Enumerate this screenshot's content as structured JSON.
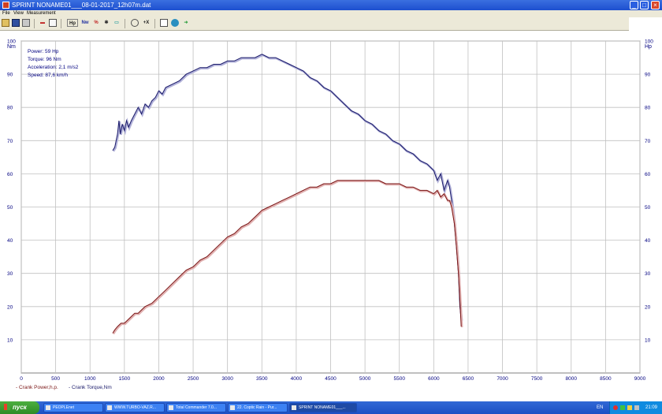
{
  "window": {
    "title": "SPRINT  NONAME01___08-01-2017_12h07m.dat",
    "buttons": {
      "minimize": "_",
      "maximize": "□",
      "close": "×"
    }
  },
  "menu": [
    "File",
    "View",
    "Measurement"
  ],
  "toolbar": {
    "icons": [
      "open-icon",
      "save-icon",
      "print-icon",
      "engine-icon",
      "chart-icon",
      "hp-toggle",
      "nm-toggle",
      "percent-toggle",
      "gear-icon",
      "motor-icon",
      "clock-icon",
      "x-axis-icon",
      "zoom-icon",
      "globe-icon",
      "arrow-icon"
    ],
    "hp_label": "Hp",
    "nm_label": "Nw",
    "pct_label": "%",
    "x_label": "+X"
  },
  "readout": {
    "power": "Power: 59 Hp",
    "torque": "Torque: 96 Nm",
    "acceleration": "Acceleration: 2,1 m/s2",
    "speed": "Speed: 87,6 km/h"
  },
  "legend": {
    "power": "- Crank Power,h.p.",
    "torque": "- Crank Torque,Nm"
  },
  "chart_data": {
    "type": "line",
    "left_axis_unit": "Nm",
    "right_axis_unit": "Hp",
    "xlim": [
      0,
      9000
    ],
    "ylim": [
      0,
      100
    ],
    "x_ticks": [
      "0",
      "500",
      "1000",
      "1500",
      "2000",
      "2500",
      "3000",
      "3500",
      "4000",
      "4500",
      "5000",
      "5500",
      "6000",
      "6500",
      "7000",
      "7500",
      "8000",
      "8500",
      "9000"
    ],
    "y_ticks": [
      "10",
      "20",
      "30",
      "40",
      "50",
      "60",
      "70",
      "80",
      "90",
      "100"
    ],
    "grid": true,
    "colors": {
      "torque": "#1a1a6a",
      "power": "#7a1515",
      "grid": "#c0c0c0"
    },
    "series": [
      {
        "name": "Crank Torque,Nm",
        "x": [
          1330,
          1360,
          1400,
          1420,
          1440,
          1470,
          1500,
          1530,
          1560,
          1600,
          1650,
          1700,
          1750,
          1800,
          1850,
          1900,
          1950,
          2000,
          2050,
          2100,
          2200,
          2300,
          2400,
          2500,
          2600,
          2700,
          2800,
          2900,
          3000,
          3100,
          3200,
          3300,
          3400,
          3500,
          3600,
          3700,
          3800,
          3900,
          4000,
          4100,
          4200,
          4300,
          4400,
          4500,
          4600,
          4700,
          4800,
          4900,
          5000,
          5100,
          5200,
          5300,
          5400,
          5500,
          5600,
          5700,
          5800,
          5900,
          6000,
          6050,
          6100,
          6150,
          6200,
          6230,
          6260,
          6300,
          6330,
          6360,
          6380,
          6400
        ],
        "values": [
          67,
          68,
          72,
          76,
          72,
          75,
          73,
          76,
          74,
          76,
          78,
          80,
          78,
          81,
          80,
          82,
          83,
          85,
          84,
          86,
          87,
          88,
          90,
          91,
          92,
          92,
          93,
          93,
          94,
          94,
          95,
          95,
          95,
          96,
          95,
          95,
          94,
          93,
          92,
          91,
          89,
          88,
          86,
          85,
          83,
          81,
          79,
          78,
          76,
          75,
          73,
          72,
          70,
          69,
          67,
          66,
          64,
          63,
          61,
          58,
          60,
          55,
          58,
          56,
          52,
          45,
          38,
          30,
          20,
          16
        ],
        "values_hp": []
      },
      {
        "name": "Crank Power,h.p.",
        "x": [
          1330,
          1360,
          1400,
          1450,
          1500,
          1550,
          1600,
          1650,
          1700,
          1750,
          1800,
          1900,
          2000,
          2100,
          2200,
          2300,
          2400,
          2500,
          2600,
          2700,
          2800,
          2900,
          3000,
          3100,
          3200,
          3300,
          3400,
          3500,
          3600,
          3700,
          3800,
          3900,
          4000,
          4100,
          4200,
          4300,
          4400,
          4500,
          4600,
          4700,
          4800,
          4900,
          5000,
          5100,
          5200,
          5300,
          5400,
          5500,
          5600,
          5700,
          5800,
          5900,
          6000,
          6050,
          6100,
          6150,
          6200,
          6230,
          6260,
          6300,
          6330,
          6360,
          6380,
          6400
        ],
        "values": [
          12,
          13,
          14,
          15,
          15,
          16,
          17,
          18,
          18,
          19,
          20,
          21,
          23,
          25,
          27,
          29,
          31,
          32,
          34,
          35,
          37,
          39,
          41,
          42,
          44,
          45,
          47,
          49,
          50,
          51,
          52,
          53,
          54,
          55,
          56,
          56,
          57,
          57,
          58,
          58,
          58,
          58,
          58,
          58,
          58,
          57,
          57,
          57,
          56,
          56,
          55,
          55,
          54,
          55,
          53,
          54,
          52,
          52,
          50,
          45,
          38,
          30,
          22,
          14
        ]
      }
    ]
  },
  "taskbar": {
    "start": "пуск",
    "tasks": [
      "PEOPLEnet",
      "WWW.TURBO-VAZ.R...",
      "Total Commander 7.0...",
      "22. Coptic Rain - Pur...",
      "SPRINT  NONAME01___..."
    ],
    "lang": "EN",
    "clock": "21:09"
  }
}
